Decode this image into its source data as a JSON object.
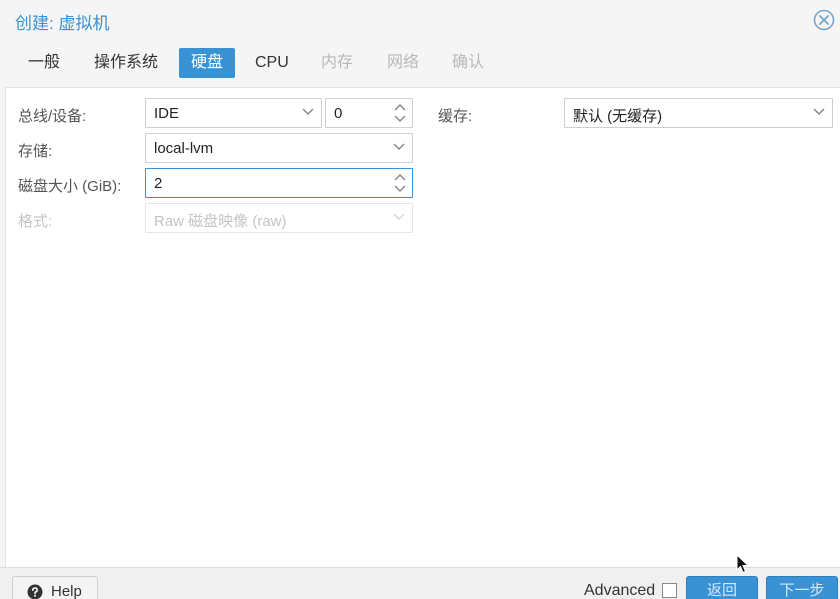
{
  "window": {
    "title": "创建: 虚拟机"
  },
  "tabs": [
    {
      "label": "一般",
      "state": "normal"
    },
    {
      "label": "操作系统",
      "state": "normal"
    },
    {
      "label": "硬盘",
      "state": "active"
    },
    {
      "label": "CPU",
      "state": "normal"
    },
    {
      "label": "内存",
      "state": "disabled"
    },
    {
      "label": "网络",
      "state": "disabled"
    },
    {
      "label": "确认",
      "state": "disabled"
    }
  ],
  "form": {
    "bus": {
      "label": "总线/设备:",
      "value": "IDE",
      "index": "0"
    },
    "storage": {
      "label": "存储:",
      "value": "local-lvm"
    },
    "size": {
      "label": "磁盘大小 (GiB):",
      "value": "2"
    },
    "format": {
      "label": "格式:",
      "value": "Raw 磁盘映像 (raw)"
    },
    "cache": {
      "label": "缓存:",
      "value": "默认 (无缓存)"
    }
  },
  "footer": {
    "help": "Help",
    "advanced": "Advanced",
    "back": "返回",
    "next": "下一步"
  },
  "colors": {
    "accent": "#3892d4",
    "panel": "#ffffff",
    "chrome": "#f5f5f5"
  },
  "icons": {
    "close": "close-circle-icon",
    "help": "question-circle-icon",
    "caret": "chevron-down-icon",
    "spinner": "spinner-arrows-icon"
  }
}
